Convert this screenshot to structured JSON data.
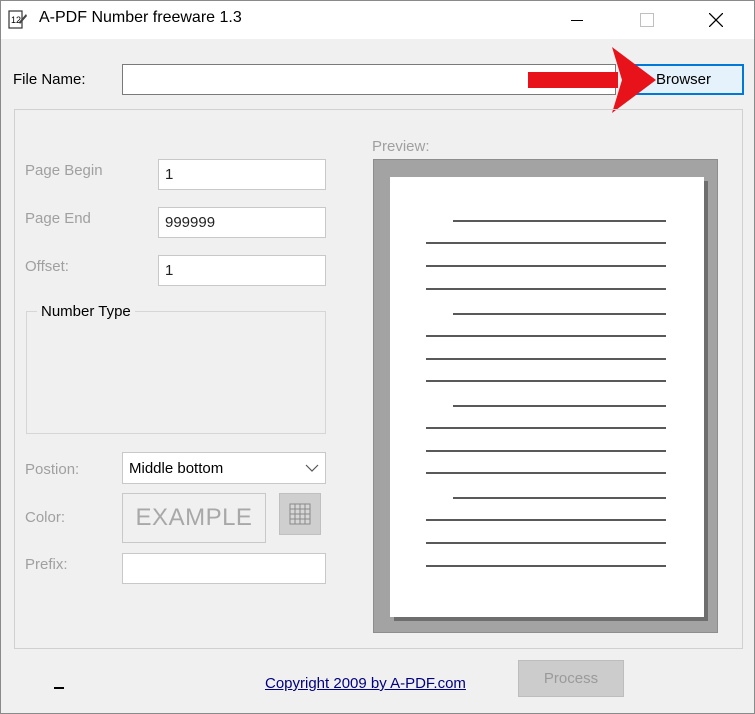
{
  "window": {
    "title": "A-PDF Number freeware 1.3",
    "icon": "app-number-icon",
    "controls": [
      "minimize-icon",
      "maximize-icon",
      "close-icon"
    ]
  },
  "file": {
    "label": "File Name:",
    "value": "",
    "browse_label": "Browser"
  },
  "form": {
    "page_begin_label": "Page Begin",
    "page_begin_value": "1",
    "page_end_label": "Page End",
    "page_end_value": "999999",
    "offset_label": "Offset:",
    "offset_value": "1",
    "number_type_label": "Number Type",
    "position_label": "Postion:",
    "position_value": "Middle bottom",
    "color_label": "Color:",
    "color_example": "EXAMPLE",
    "prefix_label": "Prefix:",
    "prefix_value": ""
  },
  "preview": {
    "label": "Preview:"
  },
  "footer": {
    "copyright": "Copyright 2009 by A-PDF.com",
    "process_label": "Process"
  },
  "colors": {
    "annotation_arrow": "#e8121b",
    "focus_border": "#0078d7",
    "disabled_text": "#a0a0a0",
    "link": "#000080"
  }
}
